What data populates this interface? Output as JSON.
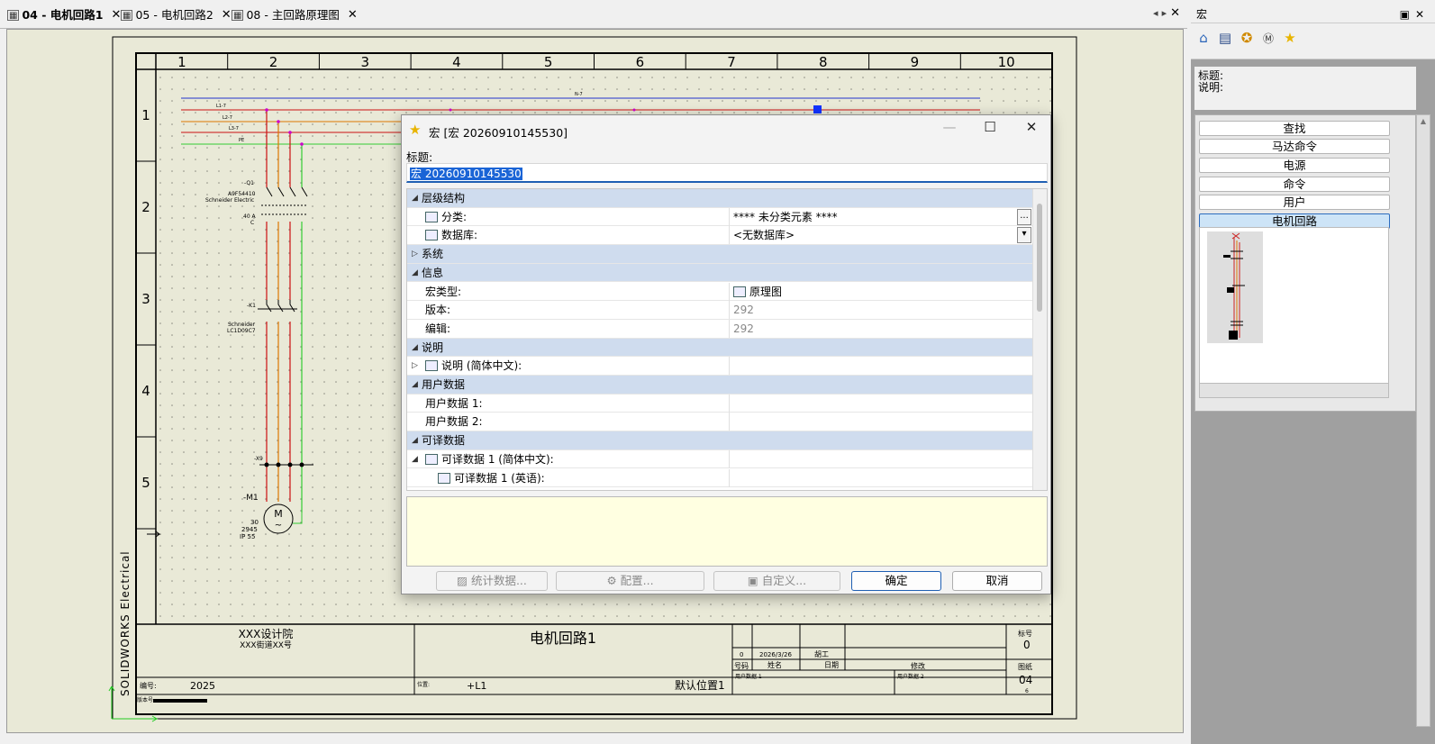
{
  "tabs": [
    {
      "label": "04 - 电机回路1",
      "active": true
    },
    {
      "label": "05 - 电机回路2",
      "active": false
    },
    {
      "label": "08 - 主回路原理图",
      "active": false
    }
  ],
  "drawing": {
    "columns": [
      "1",
      "2",
      "3",
      "4",
      "5",
      "6",
      "7",
      "8",
      "9",
      "10"
    ],
    "rows": [
      "1",
      "2",
      "3",
      "4",
      "5"
    ],
    "side_text": "SOLIDWORKS Electrical",
    "wire_labels": [
      "L1-7",
      "L2-7",
      "L3-7",
      "PE",
      "N-7"
    ],
    "q1": {
      "tag": "-Q1",
      "part": "A9F54410",
      "maker": "Schneider Electric",
      "rating": "40 A",
      "curve": "C"
    },
    "k1": {
      "tag": "-K1",
      "maker": "Schneider",
      "part": "LC1D09C7"
    },
    "x9": "-X9",
    "m1": {
      "tag": "-M1",
      "symbol": "M",
      "power": "30",
      "speed": "2945",
      "ip": "IP 55"
    },
    "title_block": {
      "company": "XXX设计院",
      "address": "XXX街道XX号",
      "drawing_title": "电机回路1",
      "code_label": "编号:",
      "code": "2025",
      "pos_label": "位置:",
      "pos": "+L1",
      "location": "默认位置1",
      "rev": "0",
      "date": "2026/3/26",
      "author": "胡工",
      "h_num": "号码",
      "h_name": "姓名",
      "h_date": "日期",
      "h_mod": "修改",
      "ud1": "用户数据 1",
      "ud2": "用户数据 2",
      "sign_label": "标号",
      "sign": "0",
      "sheet_label": "图纸",
      "sheet": "04",
      "sheet_sub": "6",
      "ver_label": "版本号"
    }
  },
  "right_panel": {
    "title": "宏",
    "tools": [
      "home-icon",
      "list-icon",
      "badge-icon",
      "motor-icon",
      "star-icon"
    ],
    "info_title_label": "标题:",
    "info_desc_label": "说明:",
    "items": [
      "查找",
      "马达命令",
      "电源",
      "命令",
      "用户",
      "电机回路"
    ],
    "selected": "电机回路"
  },
  "dialog": {
    "title": "宏 [宏 20260910145530]",
    "title_label": "标题:",
    "title_value": "宏 20260910145530",
    "rows": [
      {
        "type": "cat",
        "name": "层级结构",
        "open": true
      },
      {
        "type": "prop",
        "name": "分类:",
        "value": "**** 未分类元素 ****",
        "icon": "category-icon",
        "btn": "..."
      },
      {
        "type": "prop",
        "name": "数据库:",
        "value": "<无数据库>",
        "icon": "database-icon",
        "btn": "▾"
      },
      {
        "type": "cat",
        "name": "系统",
        "open": false
      },
      {
        "type": "cat",
        "name": "信息",
        "open": true
      },
      {
        "type": "prop",
        "name": "宏类型:",
        "value": "原理图",
        "valicon": "schematic-icon"
      },
      {
        "type": "prop",
        "name": "版本:",
        "value": "292",
        "gray": true
      },
      {
        "type": "prop",
        "name": "编辑:",
        "value": "292",
        "gray": true
      },
      {
        "type": "cat",
        "name": "说明",
        "open": true
      },
      {
        "type": "prop",
        "name": "说明 (简体中文):",
        "value": "",
        "icon": "text-icon",
        "expand": true
      },
      {
        "type": "cat",
        "name": "用户数据",
        "open": true
      },
      {
        "type": "prop",
        "name": "用户数据 1:",
        "value": ""
      },
      {
        "type": "prop",
        "name": "用户数据 2:",
        "value": ""
      },
      {
        "type": "cat",
        "name": "可译数据",
        "open": true
      },
      {
        "type": "prop",
        "name": "可译数据 1 (简体中文):",
        "value": "",
        "icon": "text-icon",
        "expanded": true
      },
      {
        "type": "prop",
        "name": "可译数据 1 (英语):",
        "value": "",
        "icon": "text-icon",
        "indent": true
      }
    ],
    "buttons": {
      "stats": "统计数据...",
      "config": "配置...",
      "custom": "自定义...",
      "ok": "确定",
      "cancel": "取消"
    }
  }
}
